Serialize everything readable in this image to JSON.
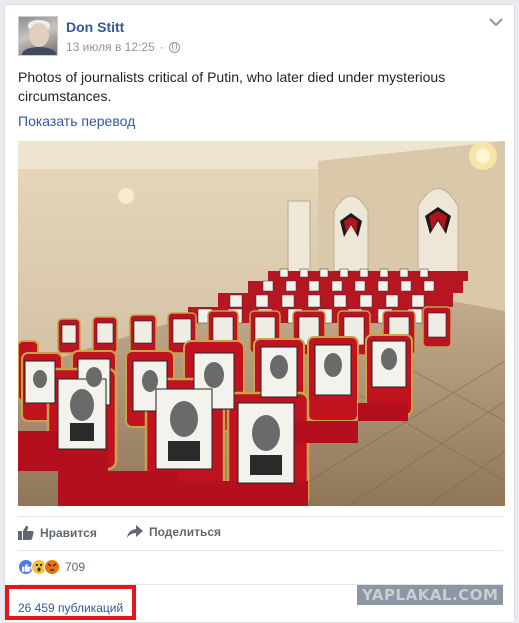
{
  "post": {
    "author": "Don Stitt",
    "timestamp": "13 июля в 12:25",
    "text": "Photos of journalists critical of Putin, who later died under mysterious circumstances.",
    "translate_link": "Показать перевод",
    "photo_icon": "photo-of-hall-with-portraits-on-red-chairs"
  },
  "actions": {
    "like_label": "Нравится",
    "share_label": "Поделиться"
  },
  "reactions": {
    "icons": [
      "like-icon",
      "wow-icon",
      "angry-icon"
    ],
    "count": "709"
  },
  "shares": {
    "count_label": "26 459 публикаций"
  },
  "watermark": {
    "text": "YAPLAKAL.COM"
  },
  "colors": {
    "link": "#365899",
    "secondary_text": "#90949c",
    "highlight_box": "#e8141b",
    "chair_red": "#c1121f",
    "chair_gold": "#c9a24a"
  }
}
